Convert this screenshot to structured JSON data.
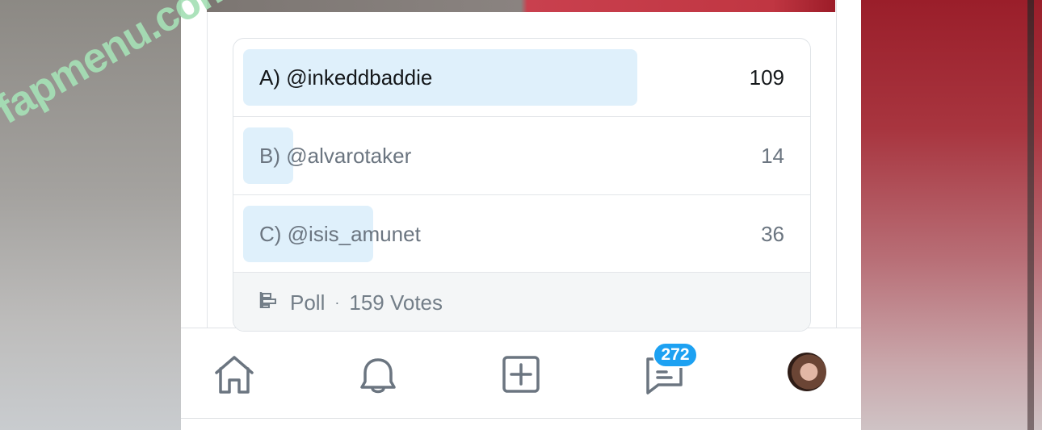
{
  "watermark": "fapmenu.com",
  "poll": {
    "options": [
      {
        "label": "A) @inkeddbaddie",
        "count": "109",
        "fraction": 0.69,
        "winner": true
      },
      {
        "label": "B) @alvarotaker",
        "count": "14",
        "fraction": 0.09,
        "winner": false
      },
      {
        "label": "C) @isis_amunet",
        "count": "36",
        "fraction": 0.23,
        "winner": false
      }
    ],
    "footer": {
      "type_label": "Poll",
      "separator": "·",
      "votes": "159 Votes"
    }
  },
  "nav": {
    "items": [
      "home-icon",
      "notifications-icon",
      "compose-icon",
      "messages-icon",
      "profile-avatar"
    ],
    "messages_badge": "272"
  },
  "colors": {
    "accent": "#1da1f2",
    "poll_fill": "#dff0fb",
    "watermark": "#a6e0b6",
    "icon": "#6b7580"
  }
}
